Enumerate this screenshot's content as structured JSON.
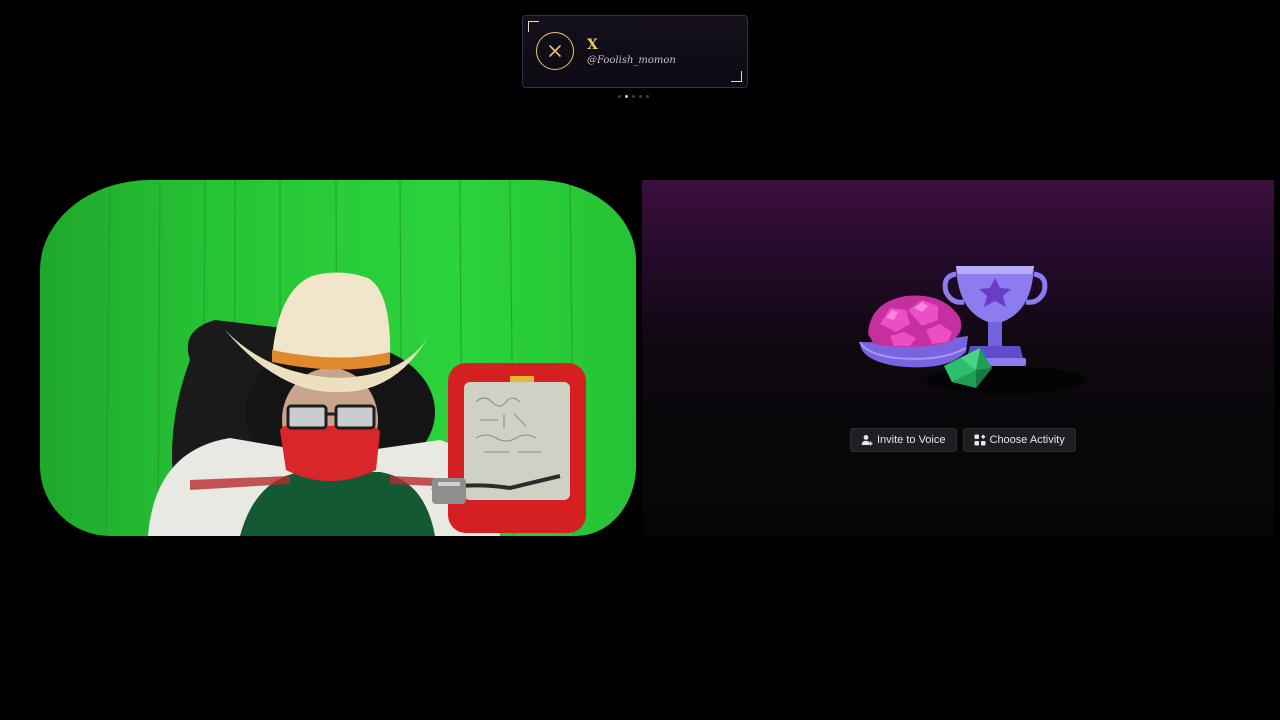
{
  "social_card": {
    "platform": "X",
    "handle": "@Foolish_momon",
    "icon": "x-close-icon",
    "accent_color": "#e8c66a"
  },
  "carousel": {
    "total": 5,
    "active": 2
  },
  "webcam": {
    "background_color": "#27c436"
  },
  "activity": {
    "art": "trophy-activity-icon",
    "invite_label": "Invite to Voice",
    "invite_icon": "add-user-icon",
    "activity_label": "Choose Activity",
    "activity_icon": "grid-icon"
  }
}
